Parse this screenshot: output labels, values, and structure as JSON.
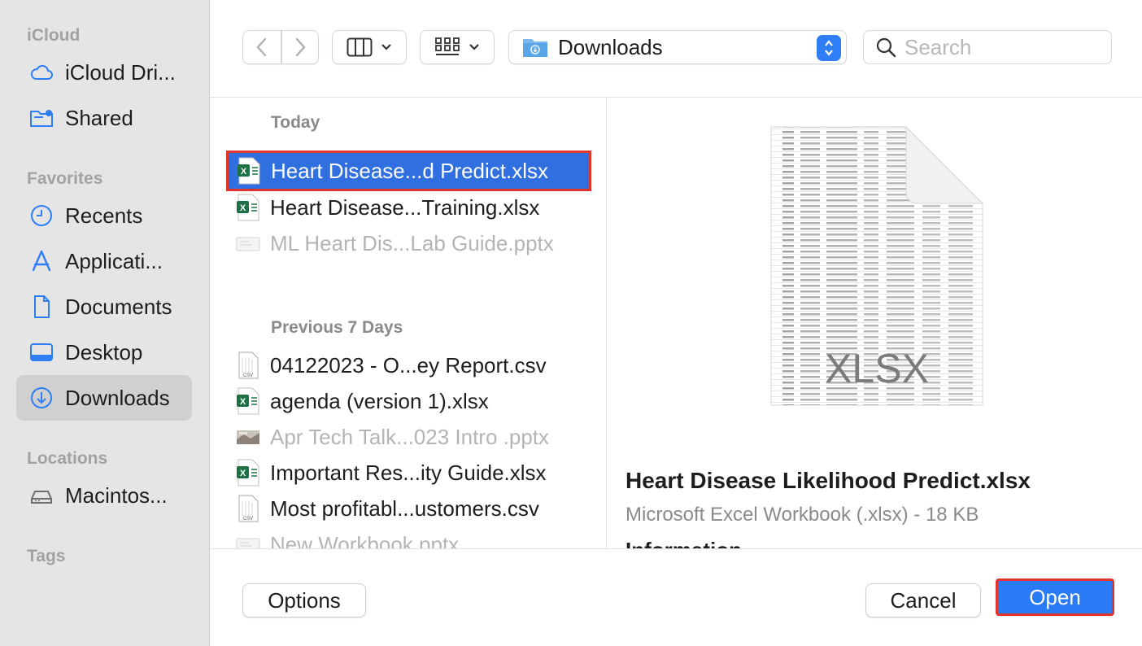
{
  "sidebar": {
    "sections": [
      {
        "title": "iCloud"
      },
      {
        "title": "Favorites"
      },
      {
        "title": "Locations"
      },
      {
        "title": "Tags"
      }
    ],
    "items": [
      {
        "label": "iCloud Dri...",
        "icon": "cloud-icon"
      },
      {
        "label": "Shared",
        "icon": "shared-folder-icon"
      },
      {
        "label": "Recents",
        "icon": "clock-icon"
      },
      {
        "label": "Applicati...",
        "icon": "applications-icon"
      },
      {
        "label": "Documents",
        "icon": "document-icon"
      },
      {
        "label": "Desktop",
        "icon": "desktop-icon"
      },
      {
        "label": "Downloads",
        "icon": "downloads-icon",
        "active": true
      },
      {
        "label": "Macintos...",
        "icon": "disk-icon"
      }
    ]
  },
  "toolbar": {
    "location": "Downloads",
    "search_placeholder": "Search"
  },
  "filelist": {
    "groups": [
      {
        "title": "Today"
      },
      {
        "title": "Previous 7 Days"
      }
    ],
    "files": [
      {
        "name": "Heart Disease...d Predict.xlsx",
        "kind": "xlsx",
        "selected": true
      },
      {
        "name": "Heart Disease...Training.xlsx",
        "kind": "xlsx"
      },
      {
        "name": "ML Heart Dis...Lab Guide.pptx",
        "kind": "pptx",
        "dim": true
      },
      {
        "name": "04122023 - O...ey Report.csv",
        "kind": "csv"
      },
      {
        "name": "agenda (version 1).xlsx",
        "kind": "xlsx"
      },
      {
        "name": "Apr Tech Talk...023 Intro .pptx",
        "kind": "pptx-image",
        "dim": true
      },
      {
        "name": "Important Res...ity Guide.xlsx",
        "kind": "xlsx"
      },
      {
        "name": "Most profitabl...ustomers.csv",
        "kind": "csv"
      },
      {
        "name": "New Workbook.pptx",
        "kind": "pptx",
        "dim": true
      }
    ]
  },
  "preview": {
    "badge": "XLSX",
    "title": "Heart Disease Likelihood Predict.xlsx",
    "subtitle": "Microsoft Excel Workbook (.xlsx) - 18 KB",
    "info_heading": "Information"
  },
  "buttons": {
    "options": "Options",
    "cancel": "Cancel",
    "open": "Open"
  },
  "colors": {
    "accent": "#2f7ef5",
    "selection": "#2f6fe0",
    "highlight_border": "#e0352b",
    "sidebar_bg": "#e6e5e6"
  }
}
